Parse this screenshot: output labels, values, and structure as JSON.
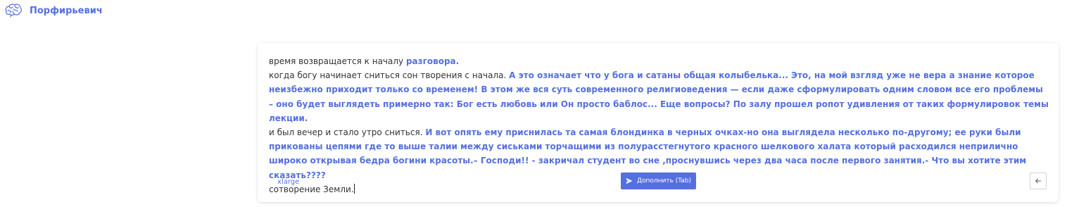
{
  "header": {
    "brand_name": "Порфирьевич",
    "logo_icon": "brain-icon"
  },
  "editor": {
    "paragraphs": [
      [
        {
          "t": "время возвращается к началу ",
          "gen": false
        },
        {
          "t": "разговора.",
          "gen": true
        }
      ],
      [
        {
          "t": "когда богу начинает сниться сон творения с начала. ",
          "gen": false
        },
        {
          "t": "А это означает что у бога и сатаны общая колыбелька... Это, на мой взгляд уже не вера а знание которое неизбежно приходит только со временем! В этом же вся суть современного религиоведения — если даже сформулировать одним словом все его проблемы – оно будет выглядеть примерно так: Бог есть любовь или Он просто баблос... Еще вопросы? По залу прошел ропот удивления от таких формулировок темы лекции.",
          "gen": true
        }
      ],
      [
        {
          "t": "и был вечер и стало утро сниться. ",
          "gen": false
        },
        {
          "t": "И вот опять ему приснилась та самая блондинка в черных очках-но она выглядела несколько по-другому; ее руки были прикованы цепями где то выше талии между сиськами торчащими из полурасстегнутого красного шелкового халата который расходился неприлично широко открывая бедра богини красоты.– Господи!! - закричал студент во сне ,проснувшись через два часа после первого занятия.- Что вы хотите этим сказать????",
          "gen": true
        }
      ],
      [
        {
          "t": "сотворение Земли.",
          "gen": false
        }
      ]
    ]
  },
  "footer": {
    "size_label": "xlarge",
    "complete_button_label": "Дополнить (Tab)",
    "complete_icon": "send-icon",
    "back_icon": "arrow-left-icon"
  },
  "colors": {
    "accent": "#5570de",
    "text": "#333333",
    "background": "#ffffff"
  }
}
